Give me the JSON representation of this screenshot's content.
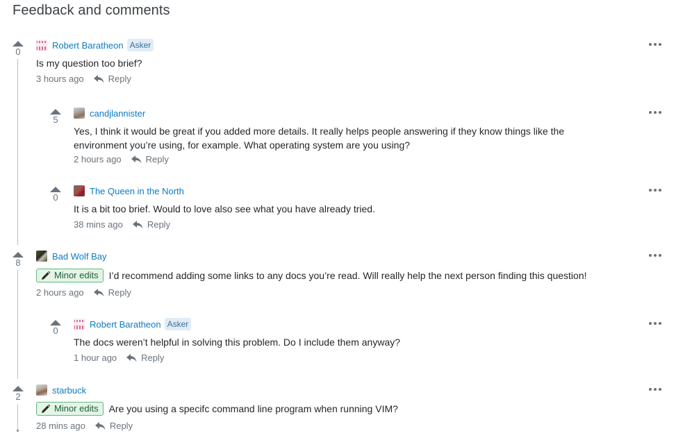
{
  "title": "Feedback and comments",
  "reply_label": "Reply",
  "badge_label": "Minor edits",
  "asker_label": "Asker",
  "comments": [
    {
      "votes": "0",
      "author": "Robert Baratheon",
      "is_asker": true,
      "avatar": "pink-identicon",
      "text": "Is my question too brief?",
      "time": "3 hours ago",
      "replies": [
        {
          "votes": "5",
          "author": "candjlannister",
          "avatar": "photo-avatar",
          "text": "Yes, I think it would be great if you added more details. It really helps people answering if they know things like the environment you’re using, for example. What operating system are you using?",
          "time": "2 hours ago"
        },
        {
          "votes": "0",
          "author": "The Queen in the North",
          "avatar": "photo-avatar",
          "text": "It is a bit too brief. Would to love also see what you have already tried.",
          "time": "38 mins ago"
        }
      ]
    },
    {
      "votes": "8",
      "author": "Bad Wolf Bay",
      "avatar": "photo-avatar",
      "badge": "Minor edits",
      "text": "I’d recommend adding some links to any docs you’re read. Will really help the next person finding this question!",
      "time": "2 hours ago",
      "replies": [
        {
          "votes": "0",
          "author": "Robert Baratheon",
          "is_asker": true,
          "avatar": "pink-identicon",
          "text": "The docs weren’t helpful in solving this problem. Do I include them anyway?",
          "time": "1 hour ago"
        }
      ]
    },
    {
      "votes": "2",
      "author": "starbuck",
      "avatar": "photo-avatar",
      "badge": "Minor edits",
      "text": "Are you using a specifc command line program when running VIM?",
      "time": "28 mins ago",
      "replies": []
    }
  ],
  "colors": {
    "link": "#0c7bc2",
    "badge_bg": "#e4f4e7",
    "badge_border": "#5eba7d",
    "asker_bg": "#e1ecf4",
    "muted": "#6a737c"
  }
}
